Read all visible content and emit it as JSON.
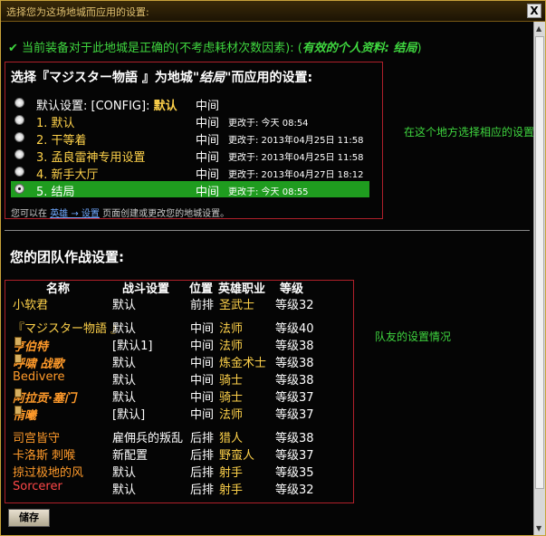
{
  "window": {
    "title": "选择您为这场地城而应用的设置:",
    "close_glyph": "X"
  },
  "status": {
    "check_icon": "check-icon",
    "text": "当前装备对于此地城是正确的(不考虑耗材次数因素): (",
    "profile": "有效的个人资料: 结局",
    "tail": ")"
  },
  "config": {
    "title_prefix": "选择『マジスター物語 』为地城\"",
    "title_dungeon": "结局",
    "title_suffix": "\"而应用的设置:",
    "rows": [
      {
        "name": "默认设置: [CONFIG]: ",
        "name_value": "默认",
        "position": "中间",
        "modified": "",
        "selected": false
      },
      {
        "name": "1. 默认",
        "position": "中间",
        "modified": "更改于: 今天 08:54",
        "selected": false
      },
      {
        "name": "2. 干等着",
        "position": "中间",
        "modified": "更改于: 2013年04月25日 11:58",
        "selected": false
      },
      {
        "name": "3. 孟良雷神专用设置",
        "position": "中间",
        "modified": "更改于: 2013年04月25日 11:58",
        "selected": false
      },
      {
        "name": "4. 新手大厅",
        "position": "中间",
        "modified": "更改于: 2013年04月27日 18:12",
        "selected": false
      },
      {
        "name": "5. 结局",
        "position": "中间",
        "modified": "更改于: 今天 08:55",
        "selected": true
      }
    ],
    "hint_prefix": "您可以在 ",
    "hint_link1": "英雄 → 设置",
    "hint_suffix": " 页面创建或更改您的地城设置。"
  },
  "annotations": {
    "config_note": "在这个地方选择相应的设置",
    "team_note": "队友的设置情况"
  },
  "team": {
    "title": "您的团队作战设置:",
    "columns": [
      "名称",
      "战斗设置",
      "位置",
      "英雄职业",
      "等级"
    ],
    "rows": [
      {
        "name": "小软君",
        "setting": "默认",
        "position": "前排",
        "class": "圣武士",
        "level": "等级32",
        "style": "yellow"
      },
      {
        "name": "『マジスター物語 』",
        "setting": "默认",
        "position": "中间",
        "class": "法师",
        "level": "等级40",
        "style": "yellow"
      },
      {
        "name": "亨伯特",
        "setting": "[默认1]",
        "position": "中间",
        "class": "法师",
        "level": "等级38",
        "style": "orange-bi",
        "lock": true
      },
      {
        "name": "呼啸 战歌",
        "setting": "默认",
        "position": "中间",
        "class": "炼金术士",
        "level": "等级38",
        "style": "orange-bi",
        "lock": true
      },
      {
        "name": "Bedivere",
        "setting": "默认",
        "position": "中间",
        "class": "骑士",
        "level": "等级38",
        "style": "orange"
      },
      {
        "name": "阿拉贡·塞门",
        "setting": "默认",
        "position": "中间",
        "class": "骑士",
        "level": "等级37",
        "style": "orange-bi",
        "lock": true
      },
      {
        "name": "侑曦",
        "setting": "[默认]",
        "position": "中间",
        "class": "法师",
        "level": "等级37",
        "style": "orange-bi",
        "lock": true
      },
      {
        "name": "司宫皆守",
        "setting": "雇佣兵的叛乱",
        "position": "后排",
        "class": "猎人",
        "level": "等级38",
        "style": "orange"
      },
      {
        "name": "卡洛斯 刺喉",
        "setting": "新配置",
        "position": "后排",
        "class": "野蛮人",
        "level": "等级37",
        "style": "orange"
      },
      {
        "name": "掠过极地的风",
        "setting": "默认",
        "position": "后排",
        "class": "射手",
        "level": "等级35",
        "style": "orange"
      },
      {
        "name": "Sorcerer",
        "setting": "默认",
        "position": "后排",
        "class": "射手",
        "level": "等级32",
        "style": "red"
      }
    ]
  },
  "save_label": "储存",
  "accent_colors": {
    "green": "#3fd63f",
    "gold": "#ffd24a",
    "orange": "#ff9a2a",
    "red": "#ff4848",
    "highlight": "#1f9c1f",
    "frame": "#b0202a"
  }
}
